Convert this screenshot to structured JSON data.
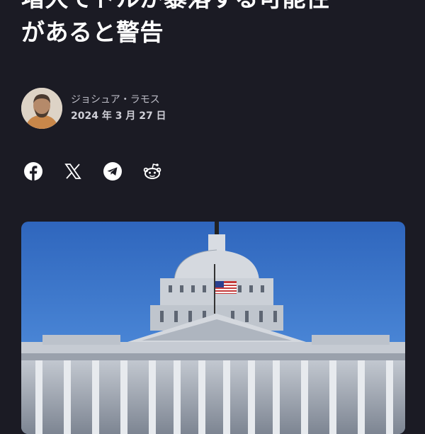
{
  "article": {
    "headline_line1": "増大でドルが暴落する可能性",
    "headline_line2": "があると警告"
  },
  "author": {
    "name": "ジョシュア・ラモス",
    "date": "2024 年 3 月 27 日"
  },
  "share": [
    {
      "icon": "facebook-icon"
    },
    {
      "icon": "x-icon"
    },
    {
      "icon": "telegram-icon"
    },
    {
      "icon": "reddit-icon"
    }
  ],
  "hero_image": {
    "subject": "capitol-building-photo"
  },
  "colors": {
    "background": "#1b1b24",
    "text": "#ffffff",
    "muted": "#bcbcc6"
  }
}
